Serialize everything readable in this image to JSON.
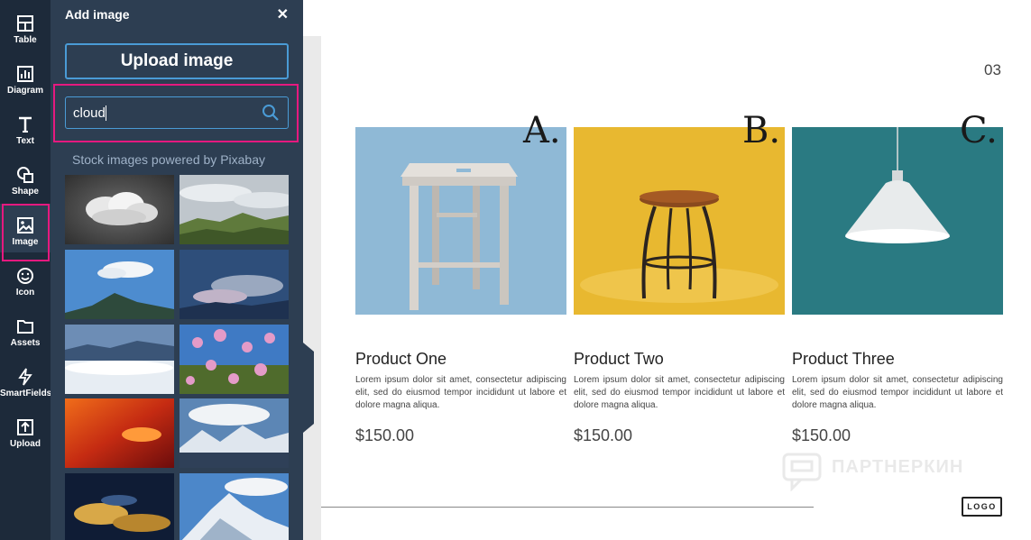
{
  "rail": {
    "items": [
      {
        "label": "Table",
        "icon": "table-icon"
      },
      {
        "label": "Diagram",
        "icon": "diagram-icon"
      },
      {
        "label": "Text",
        "icon": "text-icon"
      },
      {
        "label": "Shape",
        "icon": "shape-icon"
      },
      {
        "label": "Image",
        "icon": "image-icon",
        "active": true
      },
      {
        "label": "Icon",
        "icon": "smiley-icon"
      },
      {
        "label": "Assets",
        "icon": "folder-icon"
      },
      {
        "label": "SmartFields",
        "icon": "lightning-icon"
      },
      {
        "label": "Upload",
        "icon": "upload-icon"
      }
    ]
  },
  "panel": {
    "title": "Add image",
    "close": "✕",
    "upload_label": "Upload image",
    "search_value": "cloud",
    "stock_caption": "Stock images powered by Pixabay"
  },
  "document": {
    "page_number": "03",
    "logo_text": "LOGO",
    "watermark_text": "ПАРТНЕРКИН",
    "products": [
      {
        "letter": "A.",
        "name": "Product One",
        "description": "Lorem ipsum dolor sit amet, consectetur adipiscing elit, sed do eiusmod tempor incididunt ut labore et dolore magna aliqua.",
        "price": "$150.00"
      },
      {
        "letter": "B.",
        "name": "Product Two",
        "description": "Lorem ipsum dolor sit amet, consectetur adipiscing elit, sed do eiusmod tempor incididunt ut labore et dolore magna aliqua.",
        "price": "$150.00"
      },
      {
        "letter": "C.",
        "name": "Product Three",
        "description": "Lorem ipsum dolor sit amet, consectetur adipiscing elit, sed do eiusmod tempor incididunt ut labore et dolore magna aliqua.",
        "price": "$150.00"
      }
    ]
  },
  "colors": {
    "rail_bg": "#1d2a3a",
    "panel_bg": "#2d3e52",
    "accent_blue": "#4a9bd6",
    "highlight_pink": "#e6197f"
  }
}
